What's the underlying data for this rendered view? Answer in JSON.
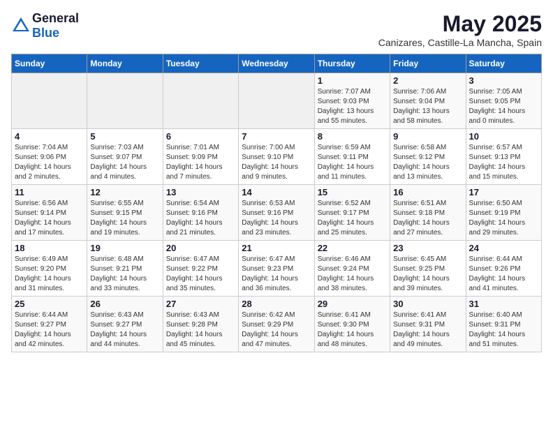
{
  "logo": {
    "general": "General",
    "blue": "Blue"
  },
  "title": "May 2025",
  "subtitle": "Canizares, Castille-La Mancha, Spain",
  "headers": [
    "Sunday",
    "Monday",
    "Tuesday",
    "Wednesday",
    "Thursday",
    "Friday",
    "Saturday"
  ],
  "weeks": [
    [
      {
        "day": "",
        "info": ""
      },
      {
        "day": "",
        "info": ""
      },
      {
        "day": "",
        "info": ""
      },
      {
        "day": "",
        "info": ""
      },
      {
        "day": "1",
        "info": "Sunrise: 7:07 AM\nSunset: 9:03 PM\nDaylight: 13 hours and 55 minutes."
      },
      {
        "day": "2",
        "info": "Sunrise: 7:06 AM\nSunset: 9:04 PM\nDaylight: 13 hours and 58 minutes."
      },
      {
        "day": "3",
        "info": "Sunrise: 7:05 AM\nSunset: 9:05 PM\nDaylight: 14 hours and 0 minutes."
      }
    ],
    [
      {
        "day": "4",
        "info": "Sunrise: 7:04 AM\nSunset: 9:06 PM\nDaylight: 14 hours and 2 minutes."
      },
      {
        "day": "5",
        "info": "Sunrise: 7:03 AM\nSunset: 9:07 PM\nDaylight: 14 hours and 4 minutes."
      },
      {
        "day": "6",
        "info": "Sunrise: 7:01 AM\nSunset: 9:09 PM\nDaylight: 14 hours and 7 minutes."
      },
      {
        "day": "7",
        "info": "Sunrise: 7:00 AM\nSunset: 9:10 PM\nDaylight: 14 hours and 9 minutes."
      },
      {
        "day": "8",
        "info": "Sunrise: 6:59 AM\nSunset: 9:11 PM\nDaylight: 14 hours and 11 minutes."
      },
      {
        "day": "9",
        "info": "Sunrise: 6:58 AM\nSunset: 9:12 PM\nDaylight: 14 hours and 13 minutes."
      },
      {
        "day": "10",
        "info": "Sunrise: 6:57 AM\nSunset: 9:13 PM\nDaylight: 14 hours and 15 minutes."
      }
    ],
    [
      {
        "day": "11",
        "info": "Sunrise: 6:56 AM\nSunset: 9:14 PM\nDaylight: 14 hours and 17 minutes."
      },
      {
        "day": "12",
        "info": "Sunrise: 6:55 AM\nSunset: 9:15 PM\nDaylight: 14 hours and 19 minutes."
      },
      {
        "day": "13",
        "info": "Sunrise: 6:54 AM\nSunset: 9:16 PM\nDaylight: 14 hours and 21 minutes."
      },
      {
        "day": "14",
        "info": "Sunrise: 6:53 AM\nSunset: 9:16 PM\nDaylight: 14 hours and 23 minutes."
      },
      {
        "day": "15",
        "info": "Sunrise: 6:52 AM\nSunset: 9:17 PM\nDaylight: 14 hours and 25 minutes."
      },
      {
        "day": "16",
        "info": "Sunrise: 6:51 AM\nSunset: 9:18 PM\nDaylight: 14 hours and 27 minutes."
      },
      {
        "day": "17",
        "info": "Sunrise: 6:50 AM\nSunset: 9:19 PM\nDaylight: 14 hours and 29 minutes."
      }
    ],
    [
      {
        "day": "18",
        "info": "Sunrise: 6:49 AM\nSunset: 9:20 PM\nDaylight: 14 hours and 31 minutes."
      },
      {
        "day": "19",
        "info": "Sunrise: 6:48 AM\nSunset: 9:21 PM\nDaylight: 14 hours and 33 minutes."
      },
      {
        "day": "20",
        "info": "Sunrise: 6:47 AM\nSunset: 9:22 PM\nDaylight: 14 hours and 35 minutes."
      },
      {
        "day": "21",
        "info": "Sunrise: 6:47 AM\nSunset: 9:23 PM\nDaylight: 14 hours and 36 minutes."
      },
      {
        "day": "22",
        "info": "Sunrise: 6:46 AM\nSunset: 9:24 PM\nDaylight: 14 hours and 38 minutes."
      },
      {
        "day": "23",
        "info": "Sunrise: 6:45 AM\nSunset: 9:25 PM\nDaylight: 14 hours and 39 minutes."
      },
      {
        "day": "24",
        "info": "Sunrise: 6:44 AM\nSunset: 9:26 PM\nDaylight: 14 hours and 41 minutes."
      }
    ],
    [
      {
        "day": "25",
        "info": "Sunrise: 6:44 AM\nSunset: 9:27 PM\nDaylight: 14 hours and 42 minutes."
      },
      {
        "day": "26",
        "info": "Sunrise: 6:43 AM\nSunset: 9:27 PM\nDaylight: 14 hours and 44 minutes."
      },
      {
        "day": "27",
        "info": "Sunrise: 6:43 AM\nSunset: 9:28 PM\nDaylight: 14 hours and 45 minutes."
      },
      {
        "day": "28",
        "info": "Sunrise: 6:42 AM\nSunset: 9:29 PM\nDaylight: 14 hours and 47 minutes."
      },
      {
        "day": "29",
        "info": "Sunrise: 6:41 AM\nSunset: 9:30 PM\nDaylight: 14 hours and 48 minutes."
      },
      {
        "day": "30",
        "info": "Sunrise: 6:41 AM\nSunset: 9:31 PM\nDaylight: 14 hours and 49 minutes."
      },
      {
        "day": "31",
        "info": "Sunrise: 6:40 AM\nSunset: 9:31 PM\nDaylight: 14 hours and 51 minutes."
      }
    ]
  ]
}
